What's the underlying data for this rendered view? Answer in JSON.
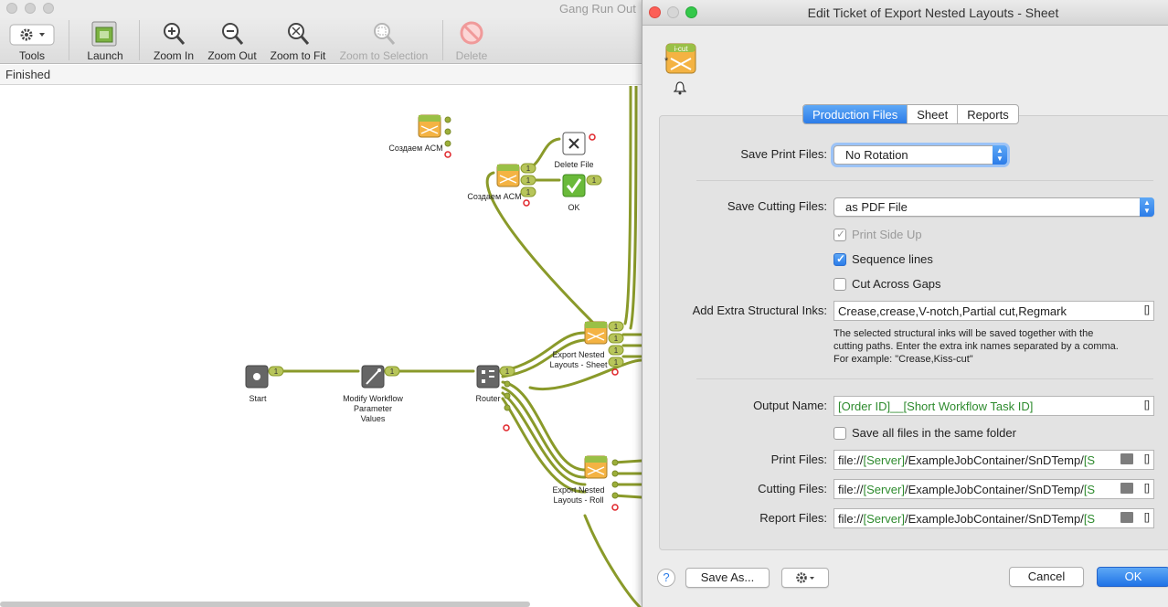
{
  "background_window": {
    "title": "Gang Run Out",
    "status": "Finished",
    "toolbar": {
      "tools": "Tools",
      "launch": "Launch",
      "zoom_in": "Zoom In",
      "zoom_out": "Zoom Out",
      "zoom_to_fit": "Zoom to Fit",
      "zoom_to_selection": "Zoom to Selection",
      "delete": "Delete"
    },
    "nodes": {
      "start": "Start",
      "modify_workflow_line1": "Modify Workflow",
      "modify_workflow_line2": "Parameter",
      "modify_workflow_line3": "Values",
      "router": "Router",
      "sozdaem_acm_1": "Создаем ACM",
      "sozdaem_acm_2": "Создаем ACM",
      "delete_file": "Delete File",
      "ok": "OK",
      "export_sheet_line1": "Export Nested",
      "export_sheet_line2": "Layouts - Sheet",
      "export_roll_line1": "Export Nested",
      "export_roll_line2": "Layouts - Roll"
    },
    "badge": "1",
    "icon_badge": "i-cut"
  },
  "dialog": {
    "title": "Edit Ticket of Export Nested Layouts - Sheet",
    "icon_badge": "i-cut",
    "tabs": [
      "Production Files",
      "Sheet",
      "Reports"
    ],
    "active_tab": "Production Files",
    "save_print_files": {
      "label": "Save Print Files:",
      "value": "No Rotation"
    },
    "save_cutting_files": {
      "label": "Save Cutting Files:",
      "value": "as PDF File"
    },
    "checkboxes": {
      "print_side_up": {
        "label": "Print Side Up",
        "checked": true,
        "enabled": false
      },
      "sequence_lines": {
        "label": "Sequence lines",
        "checked": true,
        "enabled": true
      },
      "cut_across_gaps": {
        "label": "Cut Across Gaps",
        "checked": false,
        "enabled": true
      }
    },
    "extra_inks": {
      "label": "Add Extra Structural Inks:",
      "value": "Crease,crease,V-notch,Partial cut,Regmark",
      "help_line1": "The selected structural inks will be saved together with the",
      "help_line2": "cutting paths. Enter the extra ink names separated by a comma.",
      "help_line3": "For example: \"Crease,Kiss-cut\""
    },
    "output_name": {
      "label": "Output Name:",
      "token1": "[Order ID]",
      "sep": "__",
      "token2": "[Short Workflow Task ID]"
    },
    "same_folder": {
      "label": "Save all files in the same folder",
      "checked": false
    },
    "print_files": {
      "label": "Print Files:",
      "prefix": "file://",
      "server": "[Server]",
      "path": "/ExampleJobContainer/SnDTemp/",
      "tail": "[S"
    },
    "cutting_files": {
      "label": "Cutting Files:",
      "prefix": "file://",
      "server": "[Server]",
      "path": "/ExampleJobContainer/SnDTemp/",
      "tail": "[S"
    },
    "report_files": {
      "label": "Report Files:",
      "prefix": "file://",
      "server": "[Server]",
      "path": "/ExampleJobContainer/SnDTemp/",
      "tail": "[S"
    },
    "variables_button": "[]",
    "buttons": {
      "help": "?",
      "save_as": "Save As...",
      "cancel": "Cancel",
      "ok": "OK"
    }
  },
  "colors": {
    "accent": "#2c7ce8",
    "flow_line": "#8a9a2a",
    "token_green": "#2e8b2e",
    "error_red": "#e0262b"
  }
}
